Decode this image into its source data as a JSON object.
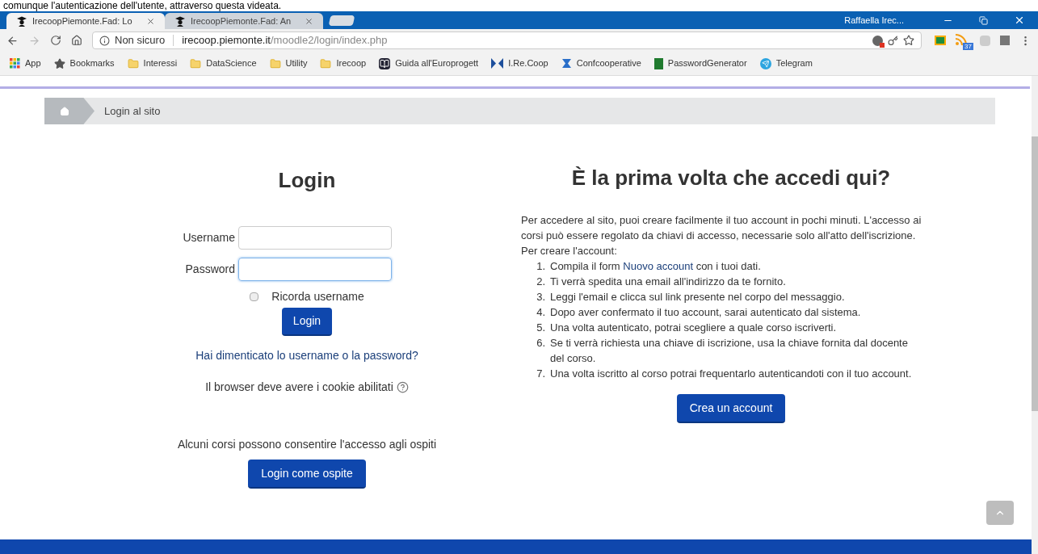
{
  "caption": "comunque l'autenticazione dell'utente, attraverso questa videata.",
  "tabs": [
    {
      "title": "IrecoopPiemonte.Fad: Lo",
      "selected": true
    },
    {
      "title": "IrecoopPiemonte.Fad: An",
      "selected": false
    }
  ],
  "window": {
    "profile": "Raffaella Irec..."
  },
  "address_bar": {
    "security": "Non sicuro",
    "url_host": "irecoop.piemonte.it",
    "url_path": "/moodle2/login/index.php"
  },
  "extension_badge": "37",
  "bookmarks": [
    {
      "label": "App",
      "kind": "apps"
    },
    {
      "label": "Bookmarks",
      "kind": "star"
    },
    {
      "label": "Interessi",
      "kind": "folder"
    },
    {
      "label": "DataScience",
      "kind": "folder"
    },
    {
      "label": "Utility",
      "kind": "folder"
    },
    {
      "label": "Irecoop",
      "kind": "folder"
    },
    {
      "label": "Guida all'Europrogett",
      "kind": "book"
    },
    {
      "label": "I.Re.Coop",
      "kind": "irecoop"
    },
    {
      "label": "Confcooperative",
      "kind": "conf"
    },
    {
      "label": "PasswordGenerator",
      "kind": "pwd"
    },
    {
      "label": "Telegram",
      "kind": "telegram"
    }
  ],
  "breadcrumb": [
    "Login al sito"
  ],
  "login": {
    "title": "Login",
    "username_label": "Username",
    "password_label": "Password",
    "remember": {
      "label": "Ricorda username",
      "checked": false
    },
    "button": "Login",
    "forgot_link": "Hai dimenticato lo username o la password?",
    "cookies_note": "Il browser deve avere i cookie abilitati",
    "guest_note": "Alcuni corsi possono consentire l'accesso agli ospiti",
    "guest_button": "Login come ospite"
  },
  "signup": {
    "title": "È la prima volta che accedi qui?",
    "intro": "Per accedere al sito, puoi creare facilmente il tuo account in pochi minuti. L'accesso ai corsi può essere regolato da chiavi di accesso, necessarie solo all'atto dell'iscrizione. Per creare l'account:",
    "steps": [
      {
        "number": "1.",
        "segments": [
          {
            "text": "Compila il form ",
            "link": false
          },
          {
            "text": "Nuovo account",
            "link": true
          },
          {
            "text": " con i tuoi dati.",
            "link": false
          }
        ]
      },
      {
        "number": "2.",
        "segments": [
          {
            "text": "Ti verrà spedita una email all'indirizzo da te fornito.",
            "link": false
          }
        ]
      },
      {
        "number": "3.",
        "segments": [
          {
            "text": "Leggi l'email e clicca sul link presente nel corpo del messaggio.",
            "link": false
          }
        ]
      },
      {
        "number": "4.",
        "segments": [
          {
            "text": "Dopo aver confermato il tuo account, sarai autenticato dal sistema.",
            "link": false
          }
        ]
      },
      {
        "number": "5.",
        "segments": [
          {
            "text": "Una volta autenticato, potrai scegliere a quale corso iscriverti.",
            "link": false
          }
        ]
      },
      {
        "number": "6.",
        "segments": [
          {
            "text": "Se ti verrà richiesta una chiave di iscrizione, usa la chiave fornita dal docente del corso.",
            "link": false
          }
        ]
      },
      {
        "number": "7.",
        "segments": [
          {
            "text": "Una volta iscritto al corso potrai frequentarlo autenticandoti con il tuo account.",
            "link": false
          }
        ]
      }
    ],
    "button": "Crea un account"
  }
}
